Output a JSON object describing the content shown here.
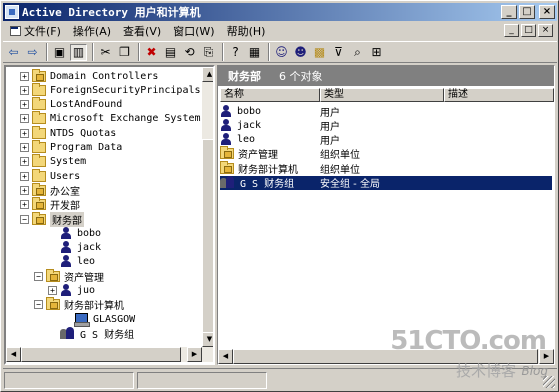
{
  "window": {
    "title": "Active Directory 用户和计算机",
    "minimize": "_",
    "maximize": "□",
    "close": "×"
  },
  "menubar": {
    "items": [
      "文件(F)",
      "操作(A)",
      "查看(V)",
      "窗口(W)",
      "帮助(H)"
    ]
  },
  "toolbar": {
    "buttons": [
      {
        "icon": "back-arrow-icon",
        "glyph": "⇦"
      },
      {
        "icon": "forward-arrow-icon",
        "glyph": "⇨"
      },
      {
        "icon": "up-folder-icon",
        "glyph": "▣"
      },
      {
        "icon": "show-tree-icon",
        "glyph": "▥"
      },
      {
        "icon": "cut-icon",
        "glyph": "✂"
      },
      {
        "icon": "copy-icon",
        "glyph": "❐"
      },
      {
        "icon": "delete-icon",
        "glyph": "✖"
      },
      {
        "icon": "properties-icon",
        "glyph": "▤"
      },
      {
        "icon": "refresh-icon",
        "glyph": "⟲"
      },
      {
        "icon": "export-icon",
        "glyph": "⎘"
      },
      {
        "icon": "help-icon",
        "glyph": "?"
      },
      {
        "icon": "help-topics-icon",
        "glyph": "▦"
      },
      {
        "icon": "new-user-icon",
        "glyph": "☺"
      },
      {
        "icon": "new-group-icon",
        "glyph": "☻"
      },
      {
        "icon": "new-ou-icon",
        "glyph": "▩"
      },
      {
        "icon": "filter-icon",
        "glyph": "⊽"
      },
      {
        "icon": "find-icon",
        "glyph": "⌕"
      },
      {
        "icon": "add-to-group-icon",
        "glyph": "⊞"
      }
    ]
  },
  "tree": {
    "items": [
      {
        "label": "Domain Controllers",
        "type": "ou",
        "expander": "+"
      },
      {
        "label": "ForeignSecurityPrincipals",
        "type": "folder",
        "expander": "+"
      },
      {
        "label": "LostAndFound",
        "type": "folder",
        "expander": "+"
      },
      {
        "label": "Microsoft Exchange System",
        "type": "folder",
        "expander": "+"
      },
      {
        "label": "NTDS Quotas",
        "type": "folder",
        "expander": "+"
      },
      {
        "label": "Program Data",
        "type": "folder",
        "expander": "+"
      },
      {
        "label": "System",
        "type": "folder",
        "expander": "+"
      },
      {
        "label": "Users",
        "type": "folder",
        "expander": "+"
      },
      {
        "label": "办公室",
        "type": "ou",
        "expander": "+"
      },
      {
        "label": "开发部",
        "type": "ou",
        "expander": "+"
      },
      {
        "label": "财务部",
        "type": "ou",
        "expander": "−",
        "selected": true
      },
      {
        "label": "bobo",
        "type": "user"
      },
      {
        "label": "jack",
        "type": "user"
      },
      {
        "label": "leo",
        "type": "user"
      },
      {
        "label": "资产管理",
        "type": "ou",
        "expander": "−"
      },
      {
        "label": "juo",
        "type": "user",
        "expander": "+"
      },
      {
        "label": "财务部计算机",
        "type": "ou",
        "expander": "−"
      },
      {
        "label": "GLASGOW",
        "type": "computer"
      },
      {
        "label": "G S 财务组",
        "type": "group"
      }
    ]
  },
  "details": {
    "title": "财务部",
    "count": "6 个对象",
    "columns": [
      "名称",
      "类型",
      "描述"
    ],
    "rows": [
      {
        "name": "bobo",
        "type": "用户",
        "icon": "user"
      },
      {
        "name": "jack",
        "type": "用户",
        "icon": "user"
      },
      {
        "name": "leo",
        "type": "用户",
        "icon": "user"
      },
      {
        "name": "资产管理",
        "type": "组织单位",
        "icon": "ou"
      },
      {
        "name": "财务部计算机",
        "type": "组织单位",
        "icon": "ou"
      },
      {
        "name": "G S 财务组",
        "type": "安全组 - 全局",
        "icon": "group",
        "selected": true
      }
    ]
  },
  "watermark": {
    "brand": "51CTO.com",
    "sub": "技术博客",
    "blog": "Blog"
  },
  "scroll": {
    "up": "▲",
    "down": "▼",
    "left": "◀",
    "right": "▶"
  }
}
